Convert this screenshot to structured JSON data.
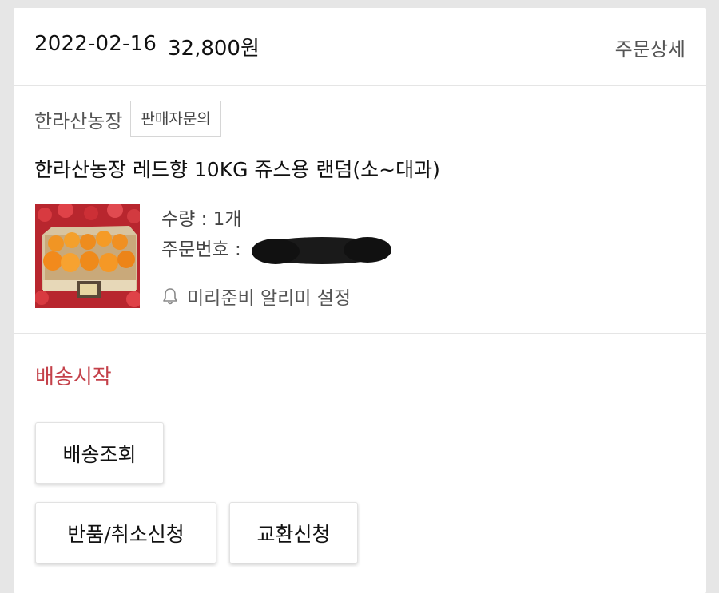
{
  "order": {
    "date": "2022-02-16",
    "price": "32,800원",
    "detail_link": "주문상세"
  },
  "seller": {
    "name": "한라산농장",
    "inquiry_label": "판매자문의"
  },
  "product": {
    "name": "한라산농장 레드향 10KG 쥬스용 랜덤(소~대과)",
    "quantity_label": "수량 : 1개",
    "order_number_label": "주문번호 :",
    "alarm_label": "미리준비 알리미 설정",
    "thumb_icon": "orange-box-image"
  },
  "status": {
    "text": "배송시작",
    "color": "#c4414a"
  },
  "buttons": {
    "track": "배송조회",
    "return_cancel": "반품/취소신청",
    "exchange": "교환신청"
  }
}
